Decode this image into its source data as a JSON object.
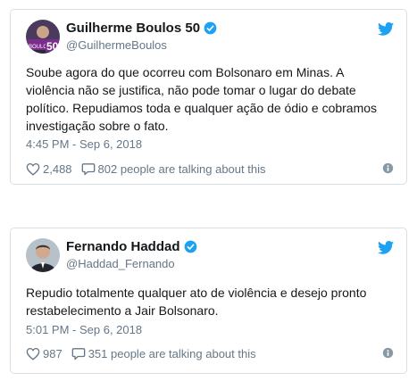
{
  "tweets": [
    {
      "name": "Guilherme Boulos 50",
      "handle": "@GuilhermeBoulos",
      "text": "Soube agora do que ocorreu com Bolsonaro em Minas. A violência não se justifica, não pode tomar o lugar do debate político. Repudiamos toda e qualquer ação de ódio e cobramos investigação sobre o fato.",
      "timestamp": "4:45 PM - Sep 6, 2018",
      "likes": "2,488",
      "talking": "802 people are talking about this",
      "avatar_badge": "50"
    },
    {
      "name": "Fernando Haddad",
      "handle": "@Haddad_Fernando",
      "text": "Repudio totalmente qualquer ato de violência e desejo pronto restabelecimento a Jair Bolsonaro.",
      "timestamp": "5:01 PM - Sep 6, 2018",
      "likes": "987",
      "talking": "351 people are talking about this"
    }
  ],
  "colors": {
    "brand_blue": "#1da1f2",
    "text": "#14171a",
    "muted": "#657786",
    "border": "#d9dfe3",
    "avatar_purple": "#7b2d8e"
  },
  "icons": {
    "platform": "twitter-bird-icon",
    "verified": "verified-badge-icon",
    "like": "heart-icon",
    "reply": "speech-bubble-icon",
    "info": "info-icon"
  }
}
